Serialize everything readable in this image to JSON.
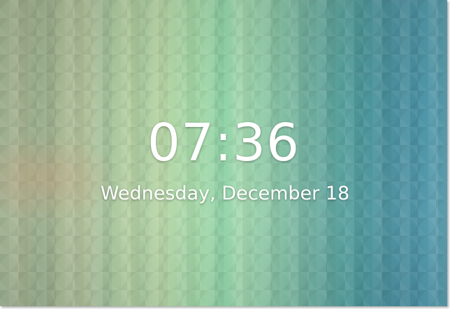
{
  "lock_screen": {
    "time": "07:36",
    "date": "Wednesday, December 18"
  },
  "colors": {
    "text": "#ffffff",
    "wallpaper_left": "#9cae8e",
    "wallpaper_center": "#8fd3a7",
    "wallpaper_right": "#4a8f9f"
  }
}
